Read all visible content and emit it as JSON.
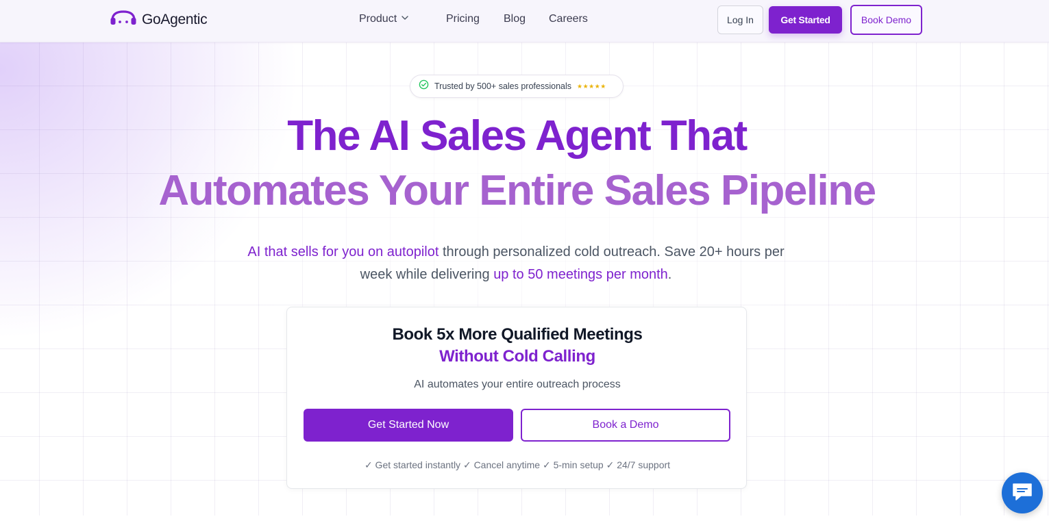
{
  "nav": {
    "brand": "GoAgentic",
    "links": {
      "product": "Product",
      "pricing": "Pricing",
      "blog": "Blog",
      "careers": "Careers"
    },
    "login_label": "Log In",
    "get_started_label": "Get Started",
    "book_demo_label": "Book Demo"
  },
  "hero": {
    "badge_text": "Trusted by 500+ sales professionals",
    "badge_stars": "★★★★★",
    "headline_line1": "The AI Sales Agent That",
    "headline_line2": "Automates Your Entire Sales Pipeline",
    "sub": {
      "part1": "AI that sells for you on autopilot",
      "part2": " through personalized cold outreach. Save 20+ hours per week while delivering ",
      "part3": "up to 50 meetings per month",
      "part4": "."
    }
  },
  "card": {
    "title": "Book 5x More Qualified Meetings",
    "title_accent": "Without Cold Calling",
    "description": "AI automates your entire outreach process",
    "primary_button": "Get Started Now",
    "secondary_button": "Book a Demo",
    "footer": "✓ Get started instantly ✓ Cancel anytime ✓ 5-min setup ✓ 24/7 support"
  },
  "colors": {
    "brand_purple": "#7e22ce",
    "headline_light_purple": "#a662cf",
    "chat_blue": "#1d6fd8",
    "star_yellow": "#eab308",
    "check_green": "#22c55e"
  },
  "icons": {
    "logo": "headset-logo-icon",
    "product_dropdown": "chevron-down-icon",
    "badge": "check-circle-icon",
    "chat": "chat-bubble-icon"
  }
}
